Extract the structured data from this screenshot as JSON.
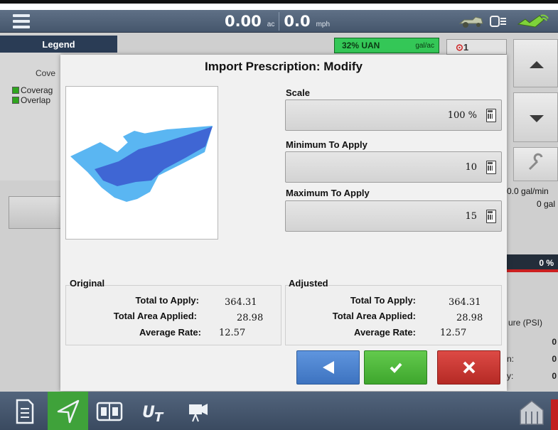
{
  "header": {
    "area_value": "0.00",
    "area_unit": "ac",
    "speed_value": "0.0",
    "speed_unit": "mph"
  },
  "legend": {
    "tab_label": "Legend",
    "heading": "Cove",
    "items": [
      {
        "label": "Coverag"
      },
      {
        "label": "Overlap"
      }
    ]
  },
  "product_badge": {
    "name": "32% UAN",
    "unit": "gal/ac"
  },
  "alarm_badge": {
    "count": "1"
  },
  "right_panel": {
    "rate": "0.0 gal/min",
    "total": "0 gal",
    "percent": "0 %",
    "pressure_label": "ure (PSI)",
    "rows": [
      {
        "label": "",
        "value": "0"
      },
      {
        "label": "n:",
        "value": "0"
      },
      {
        "label": "y:",
        "value": "0"
      }
    ]
  },
  "dialog": {
    "title": "Import Prescription: Modify",
    "scale": {
      "label": "Scale",
      "value": "100 %"
    },
    "min_apply": {
      "label": "Minimum To Apply",
      "value": "10"
    },
    "max_apply": {
      "label": "Maximum To Apply",
      "value": "15"
    },
    "original": {
      "title": "Original",
      "rows": [
        {
          "key": "Total to Apply:",
          "value": "364.31"
        },
        {
          "key": "Total Area Applied:",
          "value": "28.98"
        },
        {
          "key": "Average Rate:",
          "value": "12.57"
        }
      ]
    },
    "adjusted": {
      "title": "Adjusted",
      "rows": [
        {
          "key": "Total To Apply:",
          "value": "364.31"
        },
        {
          "key": "Total Area Applied:",
          "value": "28.98"
        },
        {
          "key": "Average Rate:",
          "value": "12.57"
        }
      ]
    }
  },
  "colors": {
    "back_button": "#4a84d1",
    "accept_button": "#4fb83b",
    "cancel_button": "#c93833",
    "topbar": "#4f5f75",
    "toolbar_active": "#3fa23a",
    "prescription_light": "#5ab6f2",
    "prescription_dark": "#3f66d4"
  },
  "icons": {
    "menu": "hamburger-menu-icon",
    "tractor": "tractor-status-icon",
    "fan": "fan-status-icon",
    "gps": "gps-signal-icon",
    "back": "left-arrow-icon",
    "accept": "checkmark-icon",
    "cancel": "close-icon",
    "toolbar": [
      "document-icon",
      "navigation-arrow-icon",
      "split-view-icon",
      "universal-terminal-icon",
      "camera-icon",
      "barn-icon"
    ]
  }
}
